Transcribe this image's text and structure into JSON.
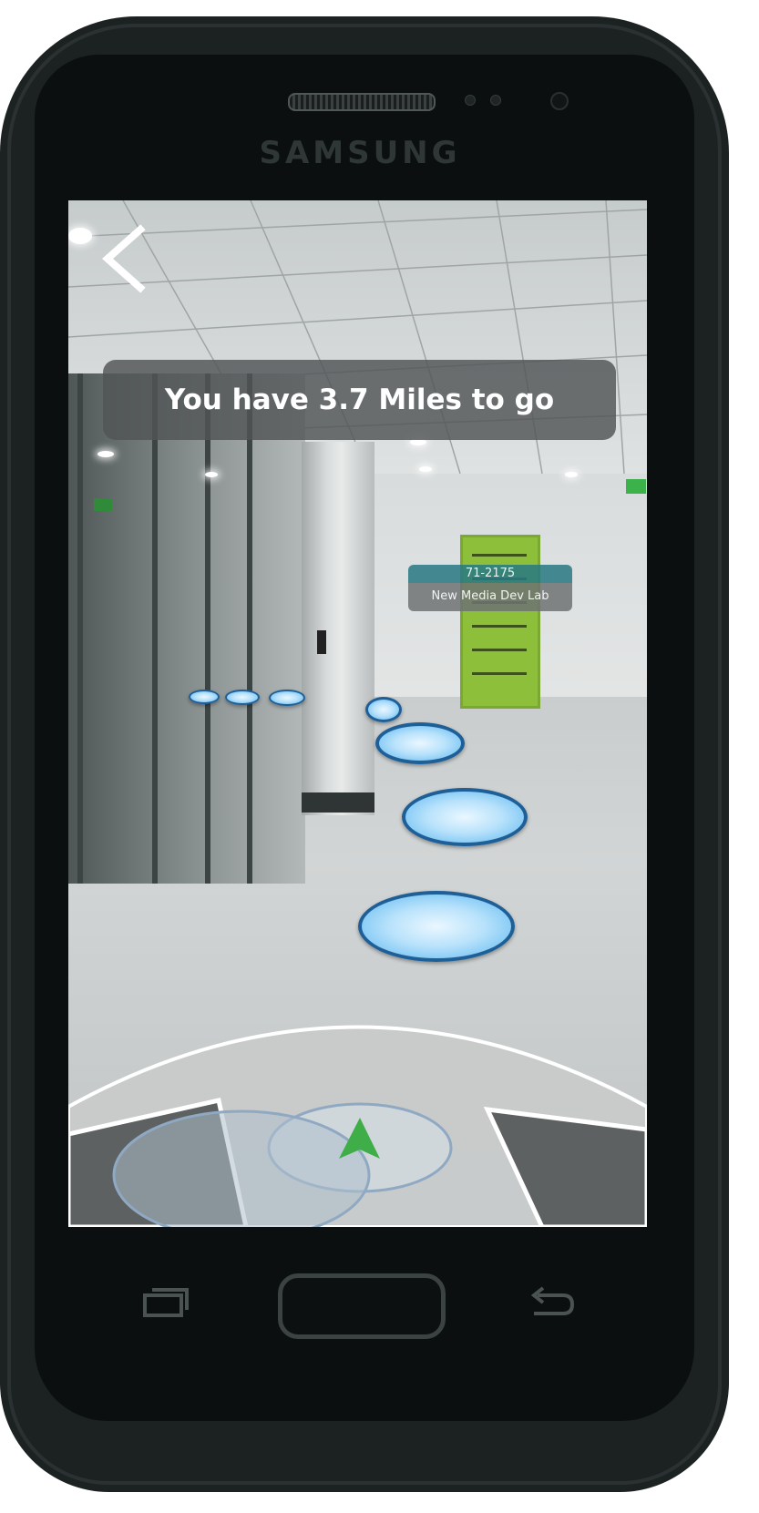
{
  "device": {
    "brand": "SAMSUNG"
  },
  "navigation": {
    "banner_text": "You have 3.7 Miles to go",
    "back_icon": "chevron-left-icon"
  },
  "room_tag": {
    "room_id": "71-2175",
    "room_name": "New Media Dev Lab"
  },
  "minimap": {
    "player_marker_icon": "green-triangle-icon",
    "marker_color": "#3fae49"
  },
  "hardware_keys": {
    "recent_apps_icon": "recent-apps-icon",
    "home_icon": "home-button",
    "back_icon": "back-arrow-icon"
  },
  "colors": {
    "waypoint_border": "#1f5f98",
    "waypoint_fill": "#8fd0f6",
    "banner_bg": "#505455",
    "door": "#8dbf3a"
  }
}
